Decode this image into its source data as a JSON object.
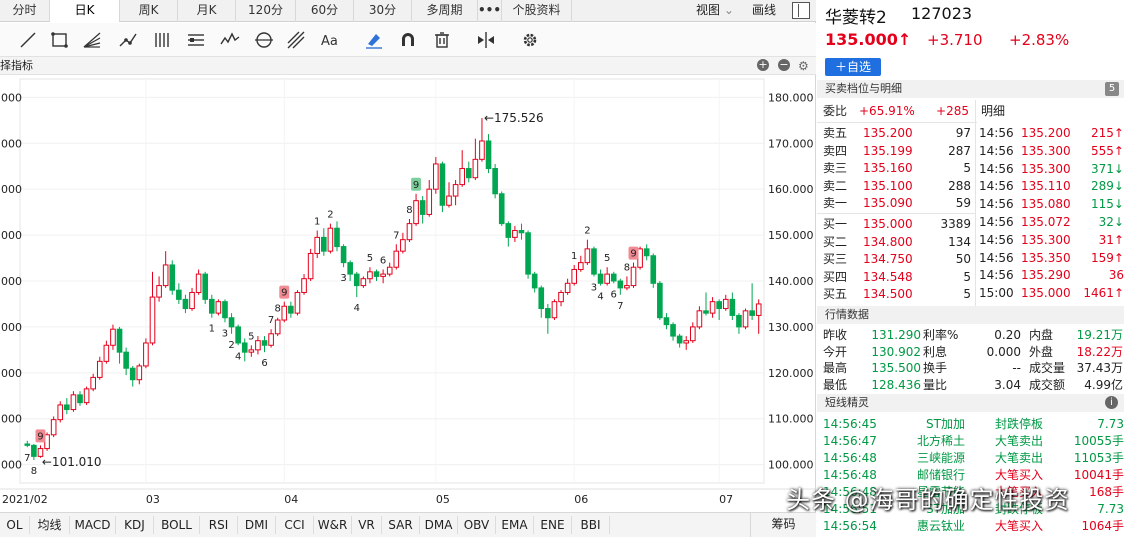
{
  "tabs": [
    {
      "label": "分时"
    },
    {
      "label": "日K"
    },
    {
      "label": "周K"
    },
    {
      "label": "月K"
    },
    {
      "label": "120分"
    },
    {
      "label": "60分"
    },
    {
      "label": "30分"
    },
    {
      "label": "多周期"
    },
    {
      "label": "•••"
    },
    {
      "label": "个股资料"
    }
  ],
  "view_menu": {
    "label": "视图",
    "arrow": "⌄",
    "draw_label": "画线"
  },
  "toolbar_icons": [
    "line-tool",
    "rect-tool",
    "fan-tool",
    "path-tool",
    "parallel-tool",
    "text-block-tool",
    "wave-tool",
    "cycle-tool",
    "pitchfork-tool",
    "text-tool",
    "eraser-tool",
    "magnet-tool",
    "delete-tool",
    "flip-tool",
    "settings-tool"
  ],
  "subheader": {
    "label": "择指标"
  },
  "chart_data": {
    "type": "candlestick",
    "ylim": [
      96,
      184
    ],
    "y_ticks": [
      100,
      110,
      120,
      130,
      140,
      150,
      160,
      170,
      180
    ],
    "y_tick_labels": [
      "100.000",
      "110.000",
      "120.000",
      "130.000",
      "140.000",
      "150.000",
      "160.000",
      "170.000",
      "180.000"
    ],
    "left_tick_labels": [
      "000",
      "000",
      "000",
      "000",
      "000",
      "000",
      "000",
      "000",
      "000"
    ],
    "x_labels": [
      "2021/02",
      "03",
      "04",
      "05",
      "06",
      "07"
    ],
    "high_annotation": "←175.526",
    "low_annotation": "←101.010",
    "td_counts": [
      {
        "text": "7",
        "i": 0
      },
      {
        "text": "8",
        "i": 1
      },
      {
        "text": "9",
        "i": 2,
        "badge": "red"
      },
      {
        "text": "1",
        "i": 28
      },
      {
        "text": "2",
        "i": 31
      },
      {
        "text": "3",
        "i": 30
      },
      {
        "text": "4",
        "i": 32
      },
      {
        "text": "5",
        "i": 34
      },
      {
        "text": "6",
        "i": 36
      },
      {
        "text": "7",
        "i": 37
      },
      {
        "text": "8",
        "i": 38
      },
      {
        "text": "9",
        "i": 39,
        "badge": "red"
      },
      {
        "text": "1",
        "i": 44
      },
      {
        "text": "2",
        "i": 46
      },
      {
        "text": "3",
        "i": 48
      },
      {
        "text": "4",
        "i": 50
      },
      {
        "text": "5",
        "i": 52
      },
      {
        "text": "6",
        "i": 54
      },
      {
        "text": "7",
        "i": 56
      },
      {
        "text": "8",
        "i": 58
      },
      {
        "text": "9",
        "i": 59,
        "badge": "green"
      },
      {
        "text": "1",
        "i": 83
      },
      {
        "text": "2",
        "i": 85
      },
      {
        "text": "3",
        "i": 86
      },
      {
        "text": "4",
        "i": 87
      },
      {
        "text": "5",
        "i": 88
      },
      {
        "text": "6",
        "i": 89
      },
      {
        "text": "7",
        "i": 90
      },
      {
        "text": "8",
        "i": 91
      },
      {
        "text": "9",
        "i": 92,
        "badge": "red"
      }
    ],
    "candles": [
      [
        104.5,
        104.2,
        105.2,
        103.8
      ],
      [
        104.2,
        101.8,
        104.5,
        101.0
      ],
      [
        101.8,
        103.5,
        104.2,
        101.5
      ],
      [
        103.5,
        106.5,
        107.0,
        103.0
      ],
      [
        106.5,
        109.8,
        110.5,
        106.0
      ],
      [
        109.8,
        113.0,
        113.8,
        109.2
      ],
      [
        113.0,
        112.0,
        114.5,
        111.0
      ],
      [
        112.0,
        115.2,
        116.0,
        111.5
      ],
      [
        115.2,
        113.5,
        116.0,
        112.8
      ],
      [
        113.5,
        116.5,
        117.0,
        113.0
      ],
      [
        116.5,
        119.0,
        119.8,
        116.0
      ],
      [
        119.0,
        122.5,
        123.5,
        118.5
      ],
      [
        122.5,
        126.0,
        127.0,
        122.0
      ],
      [
        126.0,
        129.5,
        130.5,
        125.0
      ],
      [
        129.5,
        124.5,
        130.0,
        122.0
      ],
      [
        124.5,
        121.0,
        125.5,
        119.5
      ],
      [
        121.0,
        118.5,
        121.5,
        117.0
      ],
      [
        118.5,
        121.5,
        122.0,
        117.5
      ],
      [
        121.5,
        126.5,
        127.5,
        121.0
      ],
      [
        126.5,
        136.5,
        142.0,
        126.0
      ],
      [
        136.5,
        139.0,
        141.0,
        135.5
      ],
      [
        139.0,
        143.5,
        146.5,
        138.5
      ],
      [
        143.5,
        138.0,
        144.5,
        137.0
      ],
      [
        138.0,
        136.0,
        139.5,
        135.0
      ],
      [
        136.0,
        134.0,
        137.0,
        133.0
      ],
      [
        134.0,
        137.5,
        138.5,
        133.5
      ],
      [
        137.5,
        141.5,
        142.5,
        137.0
      ],
      [
        141.5,
        136.0,
        142.0,
        135.0
      ],
      [
        136.0,
        133.0,
        137.0,
        132.0
      ],
      [
        133.0,
        135.5,
        136.0,
        132.5
      ],
      [
        135.5,
        132.0,
        136.0,
        131.0
      ],
      [
        132.0,
        130.0,
        133.0,
        128.5
      ],
      [
        130.0,
        126.5,
        130.5,
        126.0
      ],
      [
        126.5,
        124.5,
        127.5,
        122.5
      ],
      [
        124.5,
        125.0,
        126.0,
        123.5
      ],
      [
        125.0,
        127.0,
        128.0,
        124.0
      ],
      [
        127.0,
        126.0,
        128.0,
        124.5
      ],
      [
        126.0,
        128.5,
        129.5,
        125.5
      ],
      [
        128.5,
        131.5,
        132.0,
        128.0
      ],
      [
        131.5,
        134.5,
        135.5,
        131.0
      ],
      [
        134.5,
        133.0,
        135.5,
        132.0
      ],
      [
        133.0,
        137.5,
        138.0,
        132.5
      ],
      [
        137.5,
        140.5,
        141.5,
        137.0
      ],
      [
        140.5,
        146.0,
        147.0,
        140.0
      ],
      [
        146.0,
        149.5,
        151.0,
        145.0
      ],
      [
        149.5,
        146.5,
        151.5,
        145.5
      ],
      [
        146.5,
        151.5,
        152.5,
        146.0
      ],
      [
        151.5,
        147.5,
        153.0,
        146.5
      ],
      [
        147.5,
        144.0,
        148.0,
        143.0
      ],
      [
        144.0,
        141.5,
        144.5,
        140.0
      ],
      [
        141.5,
        139.0,
        142.0,
        136.5
      ],
      [
        139.0,
        140.5,
        141.0,
        138.5
      ],
      [
        140.5,
        142.0,
        143.0,
        139.5
      ],
      [
        142.0,
        141.0,
        142.5,
        140.0
      ],
      [
        141.0,
        141.5,
        142.5,
        139.5
      ],
      [
        141.5,
        143.0,
        144.0,
        141.0
      ],
      [
        143.0,
        146.5,
        148.0,
        142.5
      ],
      [
        146.5,
        149.0,
        150.5,
        146.0
      ],
      [
        149.0,
        152.5,
        153.5,
        148.5
      ],
      [
        152.5,
        157.5,
        159.0,
        152.0
      ],
      [
        157.5,
        154.5,
        158.5,
        152.5
      ],
      [
        154.5,
        160.0,
        162.0,
        154.0
      ],
      [
        160.0,
        165.5,
        167.0,
        159.0
      ],
      [
        165.5,
        156.5,
        166.0,
        155.0
      ],
      [
        156.5,
        158.5,
        161.5,
        156.0
      ],
      [
        158.5,
        161.0,
        162.0,
        156.5
      ],
      [
        161.0,
        164.5,
        168.5,
        160.5
      ],
      [
        164.5,
        162.5,
        166.0,
        161.5
      ],
      [
        162.5,
        166.5,
        171.0,
        162.0
      ],
      [
        166.5,
        170.5,
        175.5,
        166.0
      ],
      [
        170.5,
        164.5,
        172.0,
        163.5
      ],
      [
        164.5,
        159.0,
        165.5,
        158.0
      ],
      [
        159.0,
        152.5,
        159.5,
        152.0
      ],
      [
        152.5,
        149.5,
        153.0,
        147.5
      ],
      [
        149.5,
        151.0,
        152.0,
        148.5
      ],
      [
        151.0,
        150.5,
        152.5,
        149.0
      ],
      [
        150.5,
        141.5,
        151.0,
        140.5
      ],
      [
        141.5,
        138.5,
        142.0,
        137.5
      ],
      [
        138.5,
        134.0,
        139.0,
        132.0
      ],
      [
        134.0,
        132.0,
        135.0,
        128.5
      ],
      [
        132.0,
        135.5,
        136.0,
        131.5
      ],
      [
        135.5,
        137.5,
        138.0,
        134.5
      ],
      [
        137.5,
        139.5,
        140.5,
        137.0
      ],
      [
        139.5,
        142.5,
        143.5,
        139.0
      ],
      [
        142.5,
        144.0,
        145.5,
        142.0
      ],
      [
        144.0,
        147.0,
        149.0,
        143.5
      ],
      [
        147.0,
        141.5,
        147.5,
        141.0
      ],
      [
        141.5,
        139.5,
        142.5,
        139.0
      ],
      [
        139.5,
        141.5,
        143.0,
        139.0
      ],
      [
        141.5,
        140.0,
        142.0,
        139.5
      ],
      [
        140.0,
        138.5,
        140.5,
        137.0
      ],
      [
        138.5,
        139.0,
        141.0,
        138.0
      ],
      [
        139.0,
        143.0,
        144.0,
        138.5
      ],
      [
        143.0,
        147.0,
        147.5,
        142.5
      ],
      [
        147.0,
        145.5,
        148.0,
        144.5
      ],
      [
        145.5,
        139.5,
        146.0,
        138.5
      ],
      [
        139.5,
        132.0,
        140.0,
        131.5
      ],
      [
        132.0,
        130.5,
        133.0,
        129.5
      ],
      [
        130.5,
        128.0,
        131.0,
        127.0
      ],
      [
        128.0,
        126.5,
        128.5,
        125.5
      ],
      [
        126.5,
        127.0,
        128.0,
        125.0
      ],
      [
        127.0,
        130.0,
        131.0,
        126.5
      ],
      [
        130.0,
        133.5,
        134.5,
        129.5
      ],
      [
        133.5,
        133.0,
        137.5,
        132.5
      ],
      [
        133.0,
        135.5,
        136.5,
        132.0
      ],
      [
        135.5,
        134.0,
        136.0,
        131.5
      ],
      [
        134.0,
        136.0,
        137.0,
        133.5
      ],
      [
        136.0,
        132.5,
        137.5,
        131.5
      ],
      [
        132.5,
        130.0,
        133.0,
        128.5
      ],
      [
        130.0,
        133.5,
        134.0,
        129.5
      ],
      [
        133.5,
        132.5,
        139.5,
        131.5
      ],
      [
        132.5,
        135.0,
        136.0,
        128.5
      ]
    ]
  },
  "indicators": [
    "OL",
    "均线",
    "MACD",
    "KDJ",
    "BOLL",
    "RSI",
    "DMI",
    "CCI",
    "W&R",
    "VR",
    "SAR",
    "DMA",
    "OBV",
    "EMA",
    "ENE",
    "BBI"
  ],
  "chips_label": "筹码",
  "stock": {
    "name": "华菱转2",
    "code": "127023",
    "price": "135.000",
    "arrow": "↑",
    "change": "+3.710",
    "pct": "+2.83%"
  },
  "watch_button": "＋自选",
  "orderbook": {
    "title": "买卖档位与明细",
    "badge": "5",
    "weibi_label": "委比",
    "weibi_pct": "+65.91%",
    "weibi_diff": "+285",
    "detail_label": "明细",
    "sells": [
      {
        "label": "卖五",
        "price": "135.200",
        "vol": "97"
      },
      {
        "label": "卖四",
        "price": "135.199",
        "vol": "287"
      },
      {
        "label": "卖三",
        "price": "135.160",
        "vol": "5"
      },
      {
        "label": "卖二",
        "price": "135.100",
        "vol": "288"
      },
      {
        "label": "卖一",
        "price": "135.090",
        "vol": "59"
      }
    ],
    "buys": [
      {
        "label": "买一",
        "price": "135.000",
        "vol": "3389"
      },
      {
        "label": "买二",
        "price": "134.800",
        "vol": "134"
      },
      {
        "label": "买三",
        "price": "134.750",
        "vol": "50"
      },
      {
        "label": "买四",
        "price": "134.548",
        "vol": "5"
      },
      {
        "label": "买五",
        "price": "134.500",
        "vol": "5"
      }
    ],
    "ticks": [
      {
        "time": "14:56",
        "price": "135.200",
        "vol": "215↑",
        "c": "r"
      },
      {
        "time": "14:56",
        "price": "135.300",
        "vol": "555↑",
        "c": "r"
      },
      {
        "time": "14:56",
        "price": "135.300",
        "vol": "371↓",
        "c": "g"
      },
      {
        "time": "14:56",
        "price": "135.110",
        "vol": "289↓",
        "c": "g"
      },
      {
        "time": "14:56",
        "price": "135.080",
        "vol": "115↓",
        "c": "g"
      },
      {
        "time": "14:56",
        "price": "135.072",
        "vol": "32↓",
        "c": "g"
      },
      {
        "time": "14:56",
        "price": "135.300",
        "vol": "31↑",
        "c": "r"
      },
      {
        "time": "14:56",
        "price": "135.350",
        "vol": "159↑",
        "c": "r"
      },
      {
        "time": "14:56",
        "price": "135.290",
        "vol": "36",
        "c": "r"
      },
      {
        "time": "15:00",
        "price": "135.000",
        "vol": "1461↑",
        "c": "r"
      }
    ]
  },
  "quote": {
    "title": "行情数据",
    "rows": [
      {
        "l1": "昨收",
        "v1": "131.290",
        "l2": "利率%",
        "v2": "0.20",
        "l3": "内盘",
        "v3": "19.21万"
      },
      {
        "l1": "今开",
        "v1": "130.902",
        "l2": "利息",
        "v2": "0.000",
        "l3": "外盘",
        "v3": "18.22万"
      },
      {
        "l1": "最高",
        "v1": "135.500",
        "l2": "换手",
        "v2": "--",
        "l3": "成交量",
        "v3": "37.43万"
      },
      {
        "l1": "最低",
        "v1": "128.436",
        "l2": "量比",
        "v2": "3.04",
        "l3": "成交额",
        "v3": "4.99亿"
      }
    ]
  },
  "sprite": {
    "title": "短线精灵",
    "info": "i",
    "rows": [
      {
        "time": "14:56:45",
        "name": "ST加加",
        "event": "封跌停板",
        "val": "7.73"
      },
      {
        "time": "14:56:47",
        "name": "北方稀土",
        "event": "大笔卖出",
        "val": "10055手"
      },
      {
        "time": "14:56:48",
        "name": "三峡能源",
        "event": "大笔卖出",
        "val": "11053手"
      },
      {
        "time": "14:56:48",
        "name": "邮储银行",
        "event": "大笔买入",
        "val": "10041手"
      },
      {
        "time": "14:56:48",
        "name": "星雷节能",
        "event": "大笔买入",
        "val": "168手"
      },
      {
        "time": "14:56:51",
        "name": "ST加加",
        "event": "封跌停板",
        "val": "7.73"
      },
      {
        "time": "14:56:54",
        "name": "惠云钛业",
        "event": "大笔买入",
        "val": "1064手"
      }
    ]
  },
  "watermark": "头条 @海哥的确定性投资"
}
